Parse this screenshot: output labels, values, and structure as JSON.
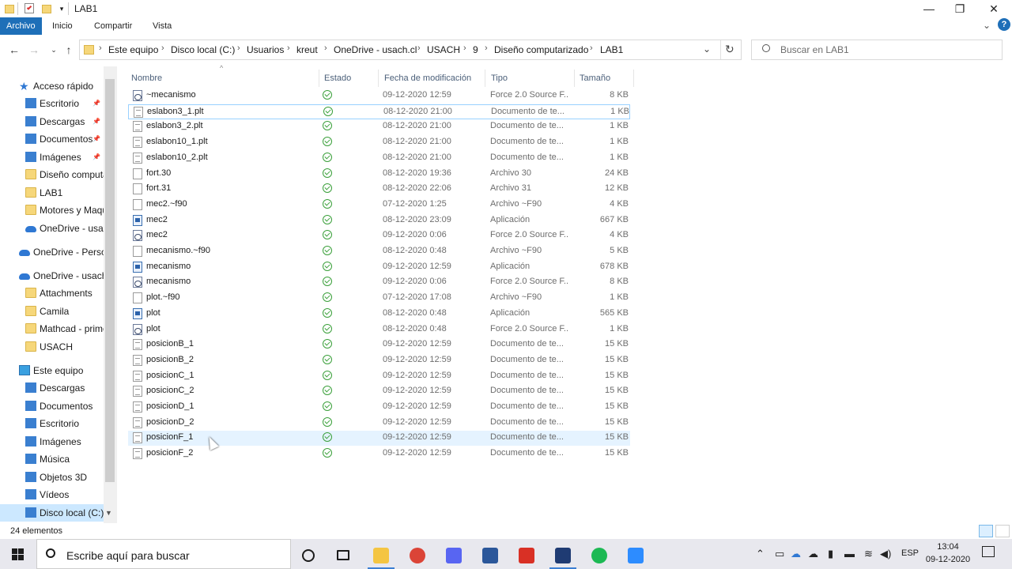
{
  "titlebar": {
    "title": "LAB1",
    "minimize": "—",
    "restore": "❐",
    "close": "✕"
  },
  "ribbon": {
    "tabs": [
      "Archivo",
      "Inicio",
      "Compartir",
      "Vista"
    ],
    "active_tab": "Archivo",
    "expand_icon": "⌄",
    "help_icon": "?"
  },
  "addressbar": {
    "breadcrumbs": [
      "Este equipo",
      "Disco local (C:)",
      "Usuarios",
      "kreut",
      "OneDrive - usach.cl",
      "USACH",
      "9",
      "Diseño computarizado",
      "LAB1"
    ],
    "separator": "›",
    "search_placeholder": "Buscar en LAB1"
  },
  "navpane": {
    "items": [
      {
        "label": "Acceso rápido",
        "icon": "star-icon",
        "level": 0,
        "pinned": false
      },
      {
        "label": "Escritorio",
        "icon": "desktop-icon",
        "level": 1,
        "pinned": true
      },
      {
        "label": "Descargas",
        "icon": "download-icon",
        "level": 1,
        "pinned": true
      },
      {
        "label": "Documentos",
        "icon": "documents-icon",
        "level": 1,
        "pinned": true
      },
      {
        "label": "Imágenes",
        "icon": "images-icon",
        "level": 1,
        "pinned": true
      },
      {
        "label": "Diseño computa",
        "icon": "folder-icon",
        "level": 1,
        "pinned": false
      },
      {
        "label": "LAB1",
        "icon": "folder-icon",
        "level": 1,
        "pinned": false
      },
      {
        "label": "Motores y Maqu",
        "icon": "folder-icon",
        "level": 1,
        "pinned": false
      },
      {
        "label": "OneDrive - usacl",
        "icon": "cloud-icon",
        "level": 1,
        "pinned": false
      },
      {
        "label": "OneDrive - Persor",
        "icon": "cloud-icon",
        "level": 0,
        "pinned": false
      },
      {
        "label": "OneDrive - usach.",
        "icon": "cloud-icon",
        "level": 0,
        "pinned": false
      },
      {
        "label": "Attachments",
        "icon": "folder-icon",
        "level": 1,
        "pinned": false
      },
      {
        "label": "Camila",
        "icon": "folder-icon",
        "level": 1,
        "pinned": false
      },
      {
        "label": "Mathcad - prime",
        "icon": "folder-icon",
        "level": 1,
        "pinned": false
      },
      {
        "label": "USACH",
        "icon": "folder-icon",
        "level": 1,
        "pinned": false
      },
      {
        "label": "Este equipo",
        "icon": "pc-icon",
        "level": 0,
        "pinned": false
      },
      {
        "label": "Descargas",
        "icon": "download-icon",
        "level": 1,
        "pinned": false
      },
      {
        "label": "Documentos",
        "icon": "documents-icon",
        "level": 1,
        "pinned": false
      },
      {
        "label": "Escritorio",
        "icon": "desktop-icon",
        "level": 1,
        "pinned": false
      },
      {
        "label": "Imágenes",
        "icon": "images-icon",
        "level": 1,
        "pinned": false
      },
      {
        "label": "Música",
        "icon": "music-icon",
        "level": 1,
        "pinned": false
      },
      {
        "label": "Objetos 3D",
        "icon": "cube-icon",
        "level": 1,
        "pinned": false
      },
      {
        "label": "Vídeos",
        "icon": "video-icon",
        "level": 1,
        "pinned": false
      },
      {
        "label": "Disco local (C:)",
        "icon": "drive-icon",
        "level": 1,
        "pinned": false
      }
    ]
  },
  "columns": {
    "name": "Nombre",
    "status": "Estado",
    "modified": "Fecha de modificación",
    "type": "Tipo",
    "size": "Tamaño"
  },
  "files": [
    {
      "name": "~mecanismo",
      "date": "09-12-2020 12:59",
      "type": "Force 2.0 Source F...",
      "size": "8 KB",
      "kind": "f2"
    },
    {
      "name": "eslabon3_1.plt",
      "date": "08-12-2020 21:00",
      "type": "Documento de te...",
      "size": "1 KB",
      "kind": "doc"
    },
    {
      "name": "eslabon3_2.plt",
      "date": "08-12-2020 21:00",
      "type": "Documento de te...",
      "size": "1 KB",
      "kind": "doc"
    },
    {
      "name": "eslabon10_1.plt",
      "date": "08-12-2020 21:00",
      "type": "Documento de te...",
      "size": "1 KB",
      "kind": "doc"
    },
    {
      "name": "eslabon10_2.plt",
      "date": "08-12-2020 21:00",
      "type": "Documento de te...",
      "size": "1 KB",
      "kind": "doc"
    },
    {
      "name": "fort.30",
      "date": "08-12-2020 19:36",
      "type": "Archivo 30",
      "size": "24 KB",
      "kind": "blank"
    },
    {
      "name": "fort.31",
      "date": "08-12-2020 22:06",
      "type": "Archivo 31",
      "size": "12 KB",
      "kind": "blank"
    },
    {
      "name": "mec2.~f90",
      "date": "07-12-2020 1:25",
      "type": "Archivo ~F90",
      "size": "4 KB",
      "kind": "blank"
    },
    {
      "name": "mec2",
      "date": "08-12-2020 23:09",
      "type": "Aplicación",
      "size": "667 KB",
      "kind": "exe"
    },
    {
      "name": "mec2",
      "date": "09-12-2020 0:06",
      "type": "Force 2.0 Source F...",
      "size": "4 KB",
      "kind": "f2"
    },
    {
      "name": "mecanismo.~f90",
      "date": "08-12-2020 0:48",
      "type": "Archivo ~F90",
      "size": "5 KB",
      "kind": "blank"
    },
    {
      "name": "mecanismo",
      "date": "09-12-2020 12:59",
      "type": "Aplicación",
      "size": "678 KB",
      "kind": "exe"
    },
    {
      "name": "mecanismo",
      "date": "09-12-2020 0:06",
      "type": "Force 2.0 Source F...",
      "size": "8 KB",
      "kind": "f2"
    },
    {
      "name": "plot.~f90",
      "date": "07-12-2020 17:08",
      "type": "Archivo ~F90",
      "size": "1 KB",
      "kind": "blank"
    },
    {
      "name": "plot",
      "date": "08-12-2020 0:48",
      "type": "Aplicación",
      "size": "565 KB",
      "kind": "exe"
    },
    {
      "name": "plot",
      "date": "08-12-2020 0:48",
      "type": "Force 2.0 Source F...",
      "size": "1 KB",
      "kind": "f2"
    },
    {
      "name": "posicionB_1",
      "date": "09-12-2020 12:59",
      "type": "Documento de te...",
      "size": "15 KB",
      "kind": "doc"
    },
    {
      "name": "posicionB_2",
      "date": "09-12-2020 12:59",
      "type": "Documento de te...",
      "size": "15 KB",
      "kind": "doc"
    },
    {
      "name": "posicionC_1",
      "date": "09-12-2020 12:59",
      "type": "Documento de te...",
      "size": "15 KB",
      "kind": "doc"
    },
    {
      "name": "posicionC_2",
      "date": "09-12-2020 12:59",
      "type": "Documento de te...",
      "size": "15 KB",
      "kind": "doc"
    },
    {
      "name": "posicionD_1",
      "date": "09-12-2020 12:59",
      "type": "Documento de te...",
      "size": "15 KB",
      "kind": "doc"
    },
    {
      "name": "posicionD_2",
      "date": "09-12-2020 12:59",
      "type": "Documento de te...",
      "size": "15 KB",
      "kind": "doc"
    },
    {
      "name": "posicionF_1",
      "date": "09-12-2020 12:59",
      "type": "Documento de te...",
      "size": "15 KB",
      "kind": "doc"
    },
    {
      "name": "posicionF_2",
      "date": "09-12-2020 12:59",
      "type": "Documento de te...",
      "size": "15 KB",
      "kind": "doc"
    }
  ],
  "selected_row": 1,
  "hovered_row": 22,
  "statusbar": {
    "count": "24 elementos"
  },
  "taskbar": {
    "search_placeholder": "Escribe aquí para buscar",
    "apps": [
      {
        "name": "cortana-icon",
        "color": "#1b1b1b"
      },
      {
        "name": "task-view-icon",
        "color": "#1b1b1b"
      },
      {
        "name": "file-explorer-icon",
        "color": "#f4c542"
      },
      {
        "name": "chrome-icon",
        "color": "#db4437"
      },
      {
        "name": "discord-icon",
        "color": "#5865f2"
      },
      {
        "name": "word-icon",
        "color": "#2b579a"
      },
      {
        "name": "acrobat-icon",
        "color": "#d93025"
      },
      {
        "name": "fortran-icon",
        "color": "#1f3b73"
      },
      {
        "name": "spotify-icon",
        "color": "#1db954"
      },
      {
        "name": "zoom-icon",
        "color": "#2d8cff"
      }
    ],
    "language": "ESP",
    "time": "13:04",
    "date": "09-12-2020"
  },
  "colors": {
    "accent": "#1e6fb8",
    "selection_border": "#99d1ff",
    "hover": "#e5f3ff",
    "sync_ok": "#3ba03b"
  }
}
